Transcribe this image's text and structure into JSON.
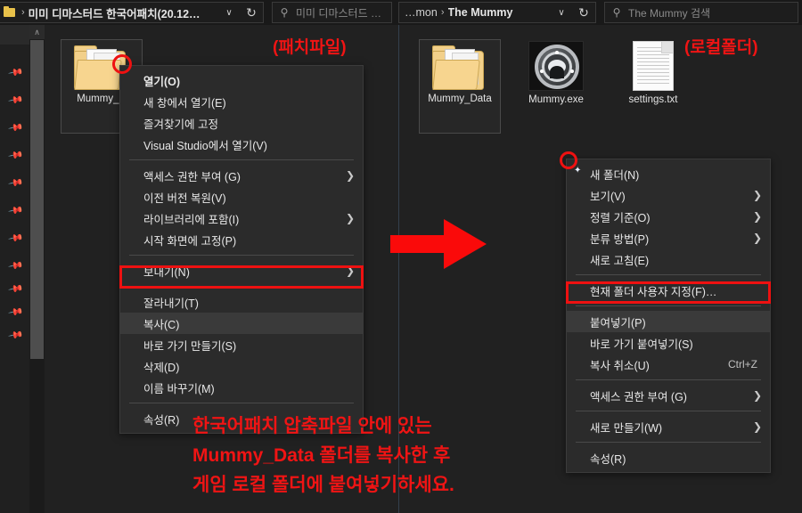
{
  "window": {
    "left_panel": {
      "address": {
        "icon": "folder-icon",
        "chevron": "›",
        "text": "미미 디마스터드 한국어패치(20.12…",
        "caret": "∨",
        "refresh": "↻"
      },
      "search": {
        "icon": "search-icon",
        "placeholder": "미미 디마스터드 …"
      },
      "items": [
        {
          "name": "Mummy_D",
          "icon": "folder-icon",
          "selected": true
        }
      ]
    },
    "right_panel": {
      "address": {
        "crumb_prev": "…mon",
        "chevron": "›",
        "text": "The Mummy",
        "caret": "∨",
        "refresh": "↻"
      },
      "search": {
        "icon": "search-icon",
        "placeholder": "The Mummy 검색"
      },
      "items": [
        {
          "name": "Mummy_Data",
          "icon": "folder-icon",
          "selected": true
        },
        {
          "name": "Mummy.exe",
          "icon": "application-icon",
          "selected": false
        },
        {
          "name": "settings.txt",
          "icon": "text-file-icon",
          "selected": false
        }
      ]
    },
    "sidebar": {
      "pin_icon": "pin-icon",
      "pin_count": 11,
      "scroll_up_icon": "∧"
    }
  },
  "context_menu_left": {
    "items": [
      {
        "label": "열기(O)",
        "bold": true,
        "submenu": false
      },
      {
        "label": "새 창에서 열기(E)",
        "submenu": false
      },
      {
        "label": "즐겨찾기에 고정",
        "submenu": false
      },
      {
        "label": "Visual Studio에서 열기(V)",
        "submenu": false
      },
      {
        "separator": true
      },
      {
        "label": "액세스 권한 부여 (G)",
        "submenu": true
      },
      {
        "label": "이전 버전 복원(V)",
        "submenu": false
      },
      {
        "label": "라이브러리에 포함(I)",
        "submenu": true
      },
      {
        "label": "시작 화면에 고정(P)",
        "submenu": false
      },
      {
        "separator": true
      },
      {
        "label": "보내기(N)",
        "submenu": true
      },
      {
        "separator": true
      },
      {
        "label": "잘라내기(T)",
        "submenu": false
      },
      {
        "label": "복사(C)",
        "submenu": false,
        "highlighted": true
      },
      {
        "label": "바로 가기 만들기(S)",
        "submenu": false
      },
      {
        "label": "삭제(D)",
        "submenu": false
      },
      {
        "label": "이름 바꾸기(M)",
        "submenu": false
      },
      {
        "separator": true
      },
      {
        "label": "속성(R)",
        "submenu": false
      }
    ]
  },
  "context_menu_right": {
    "items": [
      {
        "label": "새 폴더(N)",
        "icon": "new-folder-icon",
        "submenu": false
      },
      {
        "label": "보기(V)",
        "submenu": true
      },
      {
        "label": "정렬 기준(O)",
        "submenu": true
      },
      {
        "label": "분류 방법(P)",
        "submenu": true
      },
      {
        "label": "새로 고침(E)",
        "submenu": false
      },
      {
        "separator": true
      },
      {
        "label": "현재 폴더 사용자 지정(F)…",
        "submenu": false
      },
      {
        "separator": true
      },
      {
        "label": "붙여넣기(P)",
        "submenu": false,
        "highlighted": true
      },
      {
        "label": "바로 가기 붙여넣기(S)",
        "submenu": false
      },
      {
        "label": "복사 취소(U)",
        "submenu": false,
        "accel": "Ctrl+Z"
      },
      {
        "separator": true
      },
      {
        "label": "액세스 권한 부여 (G)",
        "submenu": true
      },
      {
        "separator": true
      },
      {
        "label": "새로 만들기(W)",
        "submenu": true
      },
      {
        "separator": true
      },
      {
        "label": "속성(R)",
        "submenu": false
      }
    ]
  },
  "annotations": {
    "label_patch": "(패치파일)",
    "label_local": "(로컬폴더)",
    "instruction_line1": "한국어패치 압축파일 안에 있는",
    "instruction_line2": "Mummy_Data 폴더를 복사한 후",
    "instruction_line3": "게임 로컬 폴더에 붙여넣기하세요.",
    "arrow_icon": "right-arrow-icon",
    "accent_color": "#f01414"
  }
}
